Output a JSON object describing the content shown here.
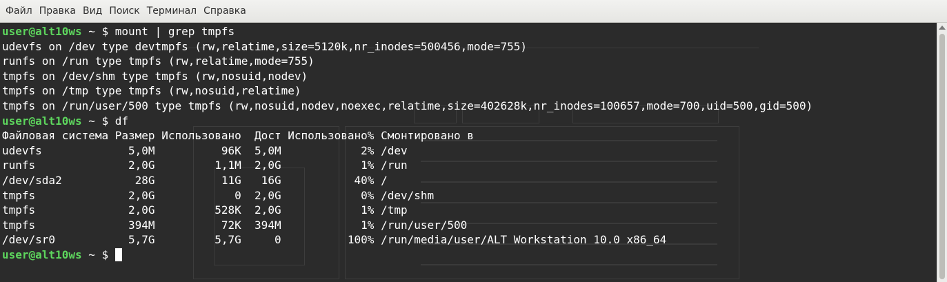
{
  "menubar": {
    "items": [
      {
        "label": "Файл"
      },
      {
        "label": "Правка"
      },
      {
        "label": "Вид"
      },
      {
        "label": "Поиск"
      },
      {
        "label": "Терминал"
      },
      {
        "label": "Справка"
      }
    ]
  },
  "terminal": {
    "prompt_user": "user@alt10ws",
    "prompt_suffix": " ~ $ ",
    "lines": [
      {
        "type": "prompt",
        "cmd": "mount | grep tmpfs"
      },
      {
        "type": "out",
        "text": "udevfs on /dev type devtmpfs (rw,relatime,size=5120k,nr_inodes=500456,mode=755)"
      },
      {
        "type": "out",
        "text": "runfs on /run type tmpfs (rw,relatime,mode=755)"
      },
      {
        "type": "out",
        "text": "tmpfs on /dev/shm type tmpfs (rw,nosuid,nodev)"
      },
      {
        "type": "out",
        "text": "tmpfs on /tmp type tmpfs (rw,nosuid,relatime)"
      },
      {
        "type": "out",
        "text": "tmpfs on /run/user/500 type tmpfs (rw,nosuid,nodev,noexec,relatime,size=402628k,nr_inodes=100657,mode=700,uid=500,gid=500)"
      },
      {
        "type": "prompt",
        "cmd": "df"
      },
      {
        "type": "out",
        "text": "Файловая система Размер Использовано  Дост Использовано% Смонтировано в"
      },
      {
        "type": "out",
        "text": "udevfs             5,0M          96K  5,0M            2% /dev"
      },
      {
        "type": "out",
        "text": "runfs              2,0G         1,1M  2,0G            1% /run"
      },
      {
        "type": "out",
        "text": "/dev/sda2           28G          11G   16G           40% /"
      },
      {
        "type": "out",
        "text": "tmpfs              2,0G            0  2,0G            0% /dev/shm"
      },
      {
        "type": "out",
        "text": "tmpfs              2,0G         528K  2,0G            1% /tmp"
      },
      {
        "type": "out",
        "text": "tmpfs              394M          72K  394M            1% /run/user/500"
      },
      {
        "type": "out",
        "text": "/dev/sr0           5,7G         5,7G     0          100% /run/media/user/ALT Workstation 10.0 x86_64"
      },
      {
        "type": "prompt",
        "cmd": "",
        "cursor": true
      }
    ]
  },
  "colors": {
    "background": "#2b2b2b",
    "foreground": "#ffffff",
    "prompt": "#5dd55d",
    "menubar": "#ececea"
  }
}
